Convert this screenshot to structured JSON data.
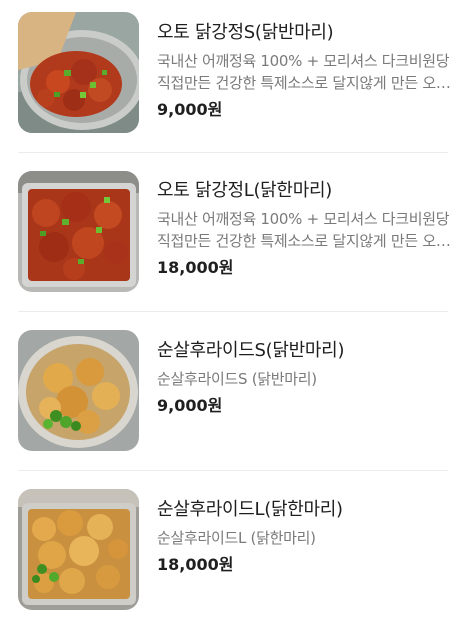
{
  "items": [
    {
      "name": "오토 닭강정S(닭반마리)",
      "description": "국내산 어깨정육 100% + 모리셔스 다크비원당 직접만든 건강한 특제소스로 달지않게 만든 오토 닭강정",
      "price": "9,000원",
      "image": "sweet-spicy-chicken-foil-tray-icon"
    },
    {
      "name": "오토 닭강정L(닭한마리)",
      "description": "국내산 어깨정육 100% + 모리셔스 다크비원당 직접만든 건강한 특제소스로 달지않게 만든 오토 닭강정",
      "price": "18,000원",
      "image": "sweet-spicy-chicken-large-tray-icon"
    },
    {
      "name": "순살후라이드S(닭반마리)",
      "description": "순살후라이드S (닭반마리)",
      "price": "9,000원",
      "image": "fried-chicken-plate-icon"
    },
    {
      "name": "순살후라이드L(닭한마리)",
      "description": "순살후라이드L (닭한마리)",
      "price": "18,000원",
      "image": "fried-chicken-tray-icon"
    }
  ]
}
